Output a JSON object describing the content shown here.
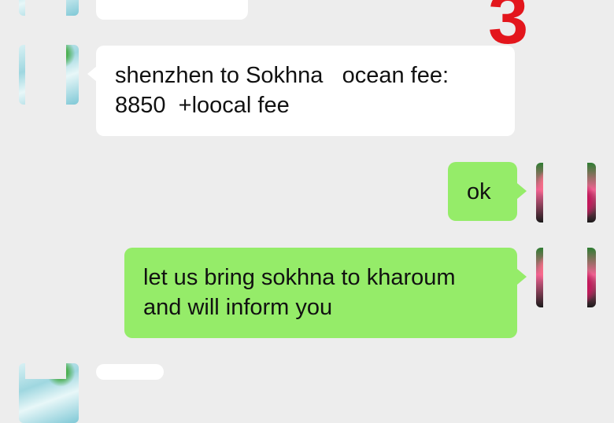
{
  "badge": {
    "number": "3"
  },
  "messages": [
    {
      "side": "left",
      "lines": []
    },
    {
      "side": "left",
      "lines": [
        "shenzhen to Sokhna   ocean fee:",
        "8850  +loocal fee"
      ]
    },
    {
      "side": "right",
      "lines": [
        "ok"
      ]
    },
    {
      "side": "right",
      "lines": [
        "let us bring sokhna to kharoum",
        "and will inform you"
      ]
    },
    {
      "side": "left",
      "lines": []
    }
  ],
  "colors": {
    "background": "#ededed",
    "incoming_bubble": "#ffffff",
    "outgoing_bubble": "#95ec69",
    "badge": "#e3161c"
  }
}
